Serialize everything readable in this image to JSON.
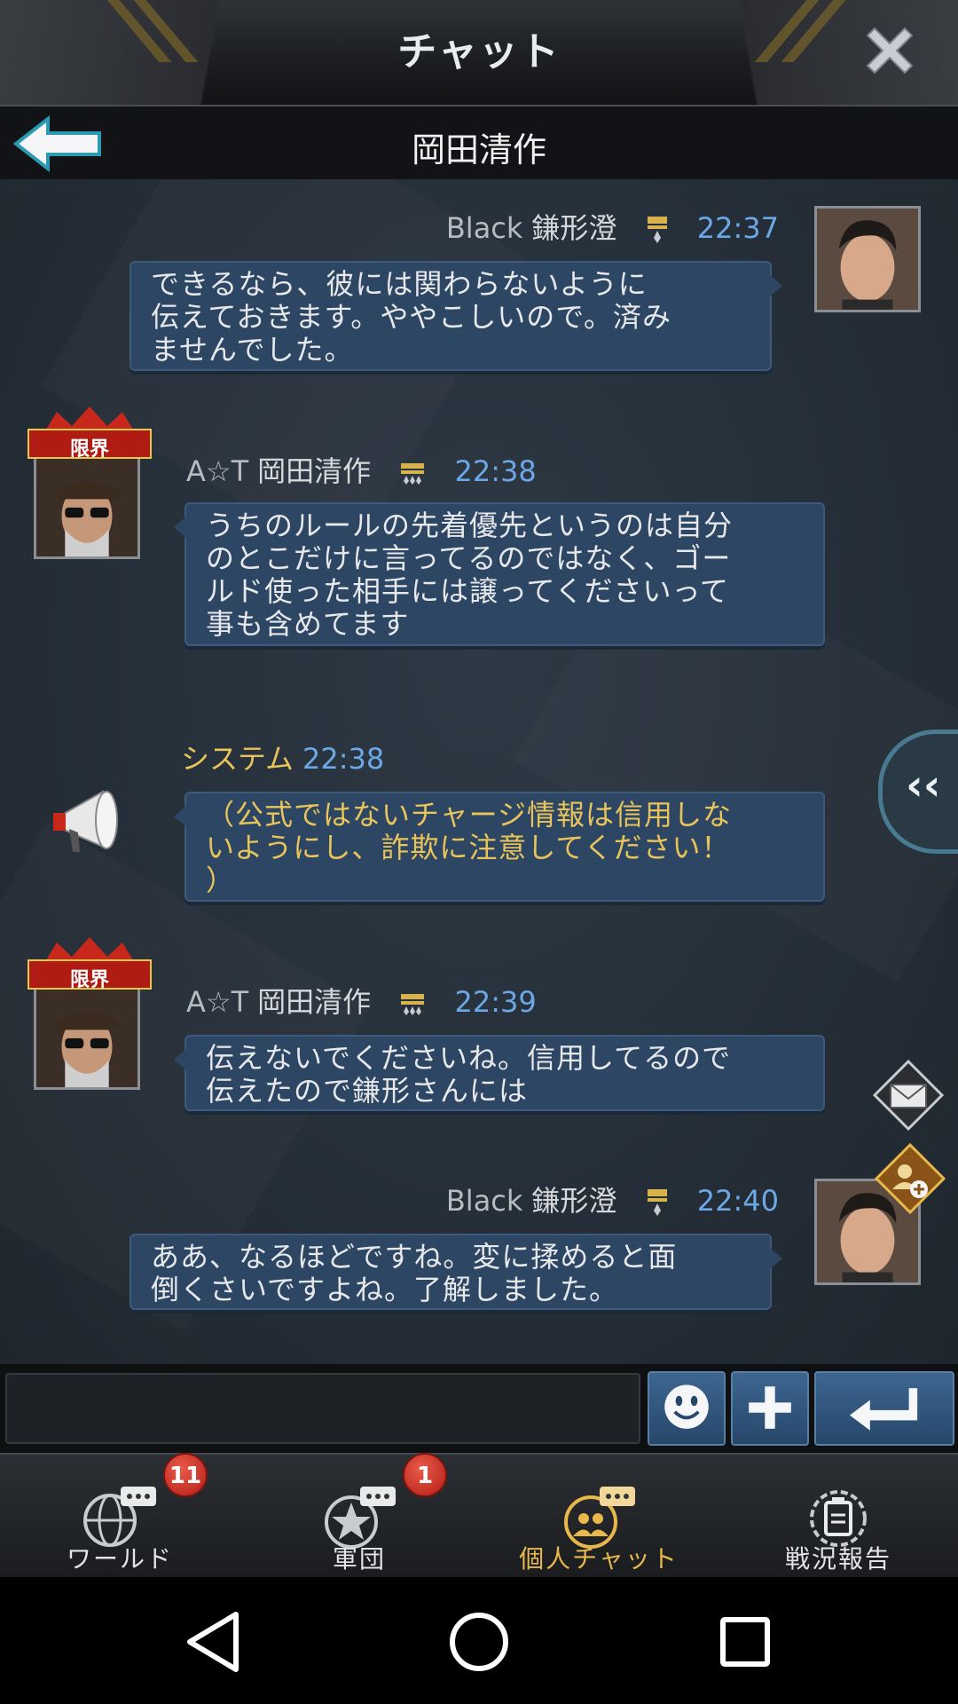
{
  "header": {
    "title": "チャット"
  },
  "subheader": {
    "title": "岡田清作"
  },
  "messages": [
    {
      "side": "right",
      "tag": "Black",
      "name": "鎌形澄",
      "time": "22:37",
      "text": "できるなら、彼には関わらないように伝えておきます。ややこしいので。済みませんでした。",
      "lines": [
        "できるなら、彼には関わらないように",
        "伝えておきます。ややこしいので。済み",
        "ませんでした。"
      ]
    },
    {
      "side": "left",
      "tag": "A☆T",
      "name": "岡田清作",
      "time": "22:38",
      "badge": "限界",
      "lines": [
        "うちのルールの先着優先というのは自分",
        "のとこだけに言ってるのではなく、ゴー",
        "ルド使った相手には譲ってくださいって",
        "事も含めてます"
      ]
    },
    {
      "side": "system",
      "name": "システム",
      "time": "22:38",
      "lines": [
        "（公式ではないチャージ情報は信用しな",
        "いようにし、詐欺に注意してください！",
        "）"
      ]
    },
    {
      "side": "left",
      "tag": "A☆T",
      "name": "岡田清作",
      "time": "22:39",
      "badge": "限界",
      "lines": [
        "伝えないでくださいね。信用してるので",
        "伝えたので鎌形さんには"
      ]
    },
    {
      "side": "right",
      "tag": "Black",
      "name": "鎌形澄",
      "time": "22:40",
      "lines": [
        "ああ、なるほどですね。変に揉めると面",
        "倒くさいですよね。了解しました。"
      ]
    }
  ],
  "input": {
    "value": "",
    "placeholder": ""
  },
  "tabs": [
    {
      "label": "ワールド",
      "badge": "11",
      "icon": "globe-chat-icon",
      "active": false
    },
    {
      "label": "軍団",
      "badge": "1",
      "icon": "star-chat-icon",
      "active": false
    },
    {
      "label": "個人チャット",
      "badge": "",
      "icon": "people-chat-icon",
      "active": true
    },
    {
      "label": "戦況報告",
      "badge": "",
      "icon": "clipboard-icon",
      "active": false
    }
  ],
  "colors": {
    "bubble": "#2d4663",
    "time": "#6da8e6",
    "system": "#e9c45a",
    "activeTab": "#e8b84a",
    "badge": "#c8281c"
  }
}
